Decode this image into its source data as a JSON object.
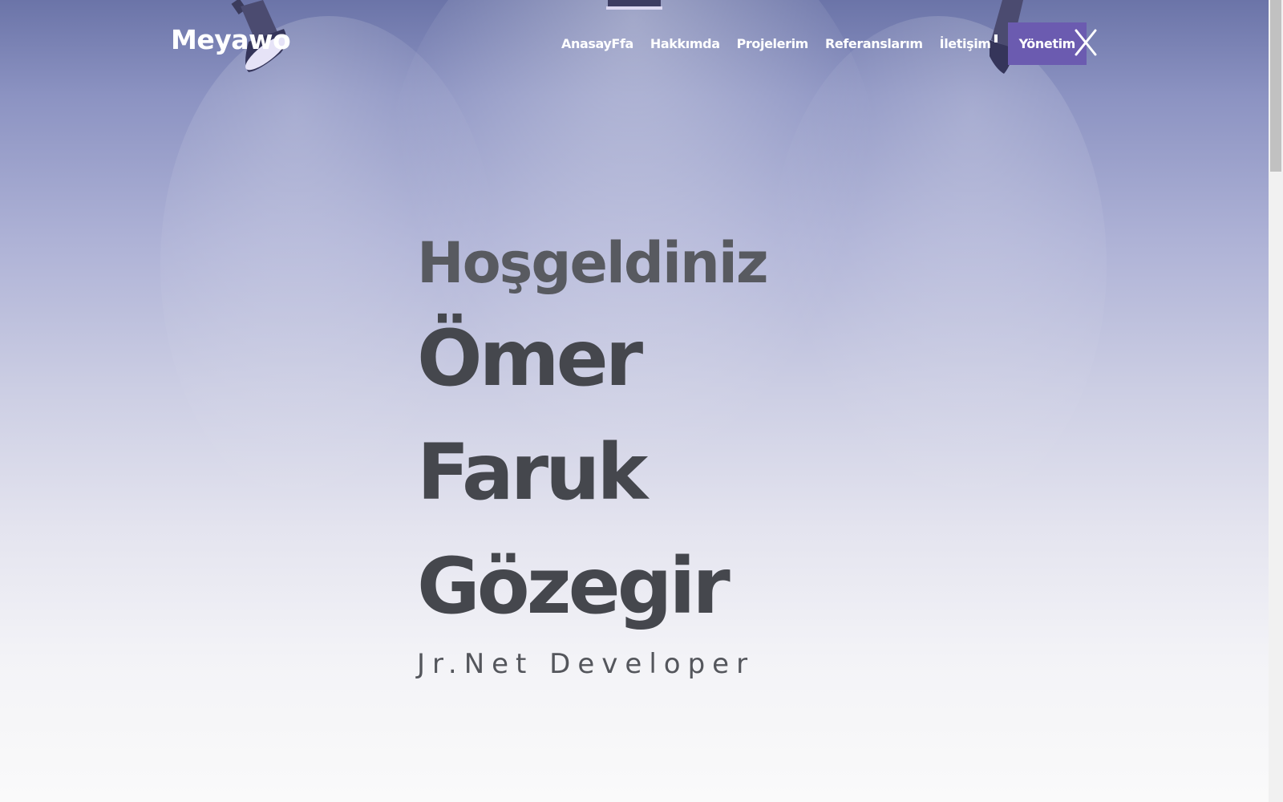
{
  "header": {
    "logo": "Meyawo",
    "nav": [
      {
        "label": "AnasayFfa"
      },
      {
        "label": "Hakkımda"
      },
      {
        "label": "Projelerim"
      },
      {
        "label": "Referanslarım"
      },
      {
        "label": "İletişim"
      }
    ],
    "admin_label": "Yönetim",
    "close_icon": "close-icon"
  },
  "hero": {
    "greeting": "Hoşgeldiniz",
    "name": "Ömer Faruk Gözegir",
    "role": "Jr.Net Developer"
  },
  "colors": {
    "accent": "#6b5bb0",
    "heading": "#45474d",
    "header_bg_top": "#6b74a8",
    "text_white": "#ffffff"
  }
}
